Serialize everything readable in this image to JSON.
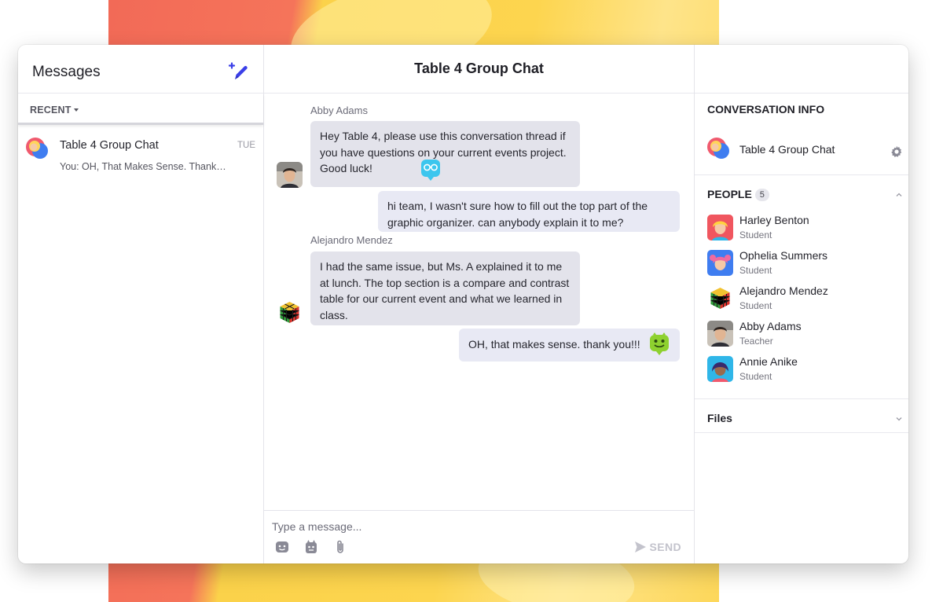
{
  "sidebar": {
    "title": "Messages",
    "compose_icon": "pencil-plus-icon",
    "filter_label": "RECENT",
    "conversations": [
      {
        "name": "Table 4 Group Chat",
        "time": "TUE",
        "preview": "You: OH, That Makes Sense. Thank you!!!"
      }
    ]
  },
  "chat": {
    "title": "Table 4 Group Chat",
    "messages": [
      {
        "sender": "Abby Adams",
        "text": "Hey Table 4, please use this conversation thread if you have questions on your current events project. Good luck!",
        "mine": false,
        "sticker": "robot-glasses-icon"
      },
      {
        "sender": "",
        "text": "hi team, I wasn't sure how to fill out the top part of the graphic organizer. can anybody explain it to me?",
        "mine": true
      },
      {
        "sender": "Alejandro Mendez",
        "text": "I had the same issue, but Ms. A explained it to me at lunch. The top section is a compare and contrast table for our current event and what we learned in class.",
        "mine": false
      },
      {
        "sender": "",
        "text": "OH, that makes sense. thank you!!!",
        "mine": true,
        "sticker": "green-monster-icon"
      }
    ],
    "composer": {
      "placeholder": "Type a message...",
      "send_label": "SEND"
    }
  },
  "info": {
    "title": "CONVERSATION INFO",
    "chat_name": "Table 4 Group Chat",
    "people_label": "PEOPLE",
    "people_count": "5",
    "people": [
      {
        "name": "Harley Benton",
        "role": "Student",
        "color": "#f0565f"
      },
      {
        "name": "Ophelia Summers",
        "role": "Student",
        "color": "#3f7df0"
      },
      {
        "name": "Alejandro Mendez",
        "role": "Student",
        "color": "#ffffff"
      },
      {
        "name": "Abby Adams",
        "role": "Teacher",
        "color": "#c9c2b8"
      },
      {
        "name": "Annie Anike",
        "role": "Student",
        "color": "#2fb6e8"
      }
    ],
    "files_label": "Files"
  },
  "colors": {
    "accent": "#3b3fe8",
    "bubble_other": "#e3e3eb",
    "bubble_mine": "#e8e9f4"
  }
}
